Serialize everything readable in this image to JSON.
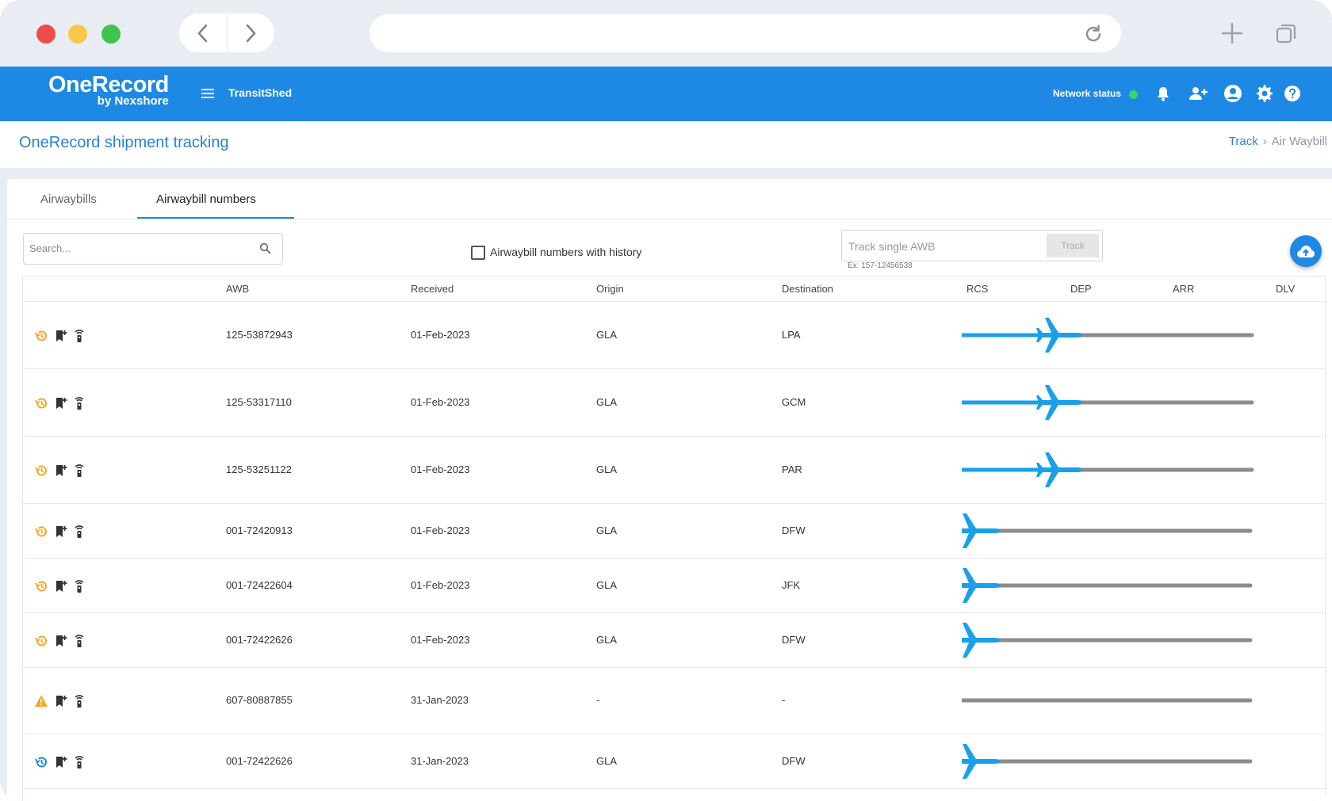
{
  "header": {
    "logo_main": "OneRecord",
    "logo_sub": "by Nexshore",
    "app_title": "TransitShed",
    "network_status_label": "Network status"
  },
  "page": {
    "title": "OneRecord shipment tracking",
    "breadcrumb_link": "Track",
    "breadcrumb_sep": "›",
    "breadcrumb_current": "Air Waybill"
  },
  "tabs": [
    {
      "label": "Airwaybills",
      "active": false
    },
    {
      "label": "Airwaybill numbers",
      "active": true
    }
  ],
  "filters": {
    "search_placeholder": "Search...",
    "history_checkbox_label": "Airwaybill numbers with history",
    "history_checked": false,
    "track_placeholder": "Track single AWB",
    "track_button": "Track",
    "track_hint": "Ex: 157-12456538"
  },
  "table": {
    "columns": [
      "AWB",
      "Received",
      "Origin",
      "Destination",
      "RCS",
      "DEP",
      "ARR",
      "DLV"
    ],
    "rows": [
      {
        "awb": "125-53872943",
        "received": "01-Feb-2023",
        "origin": "GLA",
        "destination": "LPA",
        "status_icon": "history-icon",
        "stage": "DEP"
      },
      {
        "awb": "125-53317110",
        "received": "01-Feb-2023",
        "origin": "GLA",
        "destination": "GCM",
        "status_icon": "history-icon",
        "stage": "DEP"
      },
      {
        "awb": "125-53251122",
        "received": "01-Feb-2023",
        "origin": "GLA",
        "destination": "PAR",
        "status_icon": "history-icon",
        "stage": "DEP"
      },
      {
        "awb": "001-72420913",
        "received": "01-Feb-2023",
        "origin": "GLA",
        "destination": "DFW",
        "status_icon": "history-icon",
        "stage": "RCS"
      },
      {
        "awb": "001-72422604",
        "received": "01-Feb-2023",
        "origin": "GLA",
        "destination": "JFK",
        "status_icon": "history-icon",
        "stage": "RCS"
      },
      {
        "awb": "001-72422626",
        "received": "01-Feb-2023",
        "origin": "GLA",
        "destination": "DFW",
        "status_icon": "history-icon",
        "stage": "RCS"
      },
      {
        "awb": "607-80887855",
        "received": "31-Jan-2023",
        "origin": "-",
        "destination": "-",
        "status_icon": "warning-icon",
        "stage": "none"
      },
      {
        "awb": "001-72422626",
        "received": "31-Jan-2023",
        "origin": "GLA",
        "destination": "DFW",
        "status_icon": "history-blue-icon",
        "stage": "RCS"
      }
    ]
  },
  "colors": {
    "brand": "#1e88e5",
    "history": "#f5a623",
    "history_blue": "#1e88e5",
    "warning": "#f5a623",
    "progress_done": "#1aa0e8",
    "progress_pending": "#8c8c8c",
    "plane": "#1aa0e8"
  },
  "icons": [
    "back-icon",
    "forward-icon",
    "reload-icon",
    "new-tab-icon",
    "tabs-icon",
    "menu-icon",
    "bell-icon",
    "add-user-icon",
    "account-icon",
    "settings-icon",
    "help-icon",
    "search-icon",
    "cloud-upload-icon",
    "bookmark-icon",
    "sensor-icon",
    "plane-icon"
  ]
}
